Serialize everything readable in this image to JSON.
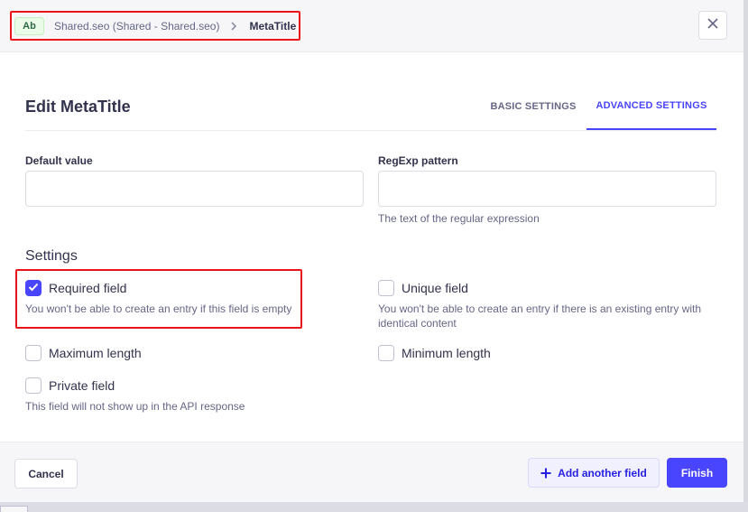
{
  "header": {
    "badge": "Ab",
    "parent": "Shared.seo (Shared - Shared.seo)",
    "current": "MetaTitle"
  },
  "title": "Edit MetaTitle",
  "tabs": [
    {
      "label": "BASIC SETTINGS",
      "active": false
    },
    {
      "label": "ADVANCED SETTINGS",
      "active": true
    }
  ],
  "fields": {
    "default_value": {
      "label": "Default value",
      "value": ""
    },
    "regexp": {
      "label": "RegExp pattern",
      "value": "",
      "hint": "The text of the regular expression"
    }
  },
  "settings": {
    "title": "Settings",
    "required": {
      "label": "Required field",
      "checked": true,
      "hint": "You won't be able to create an entry if this field is empty"
    },
    "unique": {
      "label": "Unique field",
      "checked": false,
      "hint": "You won't be able to create an entry if there is an existing entry with identical content"
    },
    "max_length": {
      "label": "Maximum length",
      "checked": false
    },
    "min_length": {
      "label": "Minimum length",
      "checked": false
    },
    "private": {
      "label": "Private field",
      "checked": false,
      "hint": "This field will not show up in the API response"
    }
  },
  "footer": {
    "cancel": "Cancel",
    "add_field": "Add another field",
    "finish": "Finish"
  },
  "colors": {
    "primary": "#4945ff",
    "highlight": "#e8141a"
  }
}
